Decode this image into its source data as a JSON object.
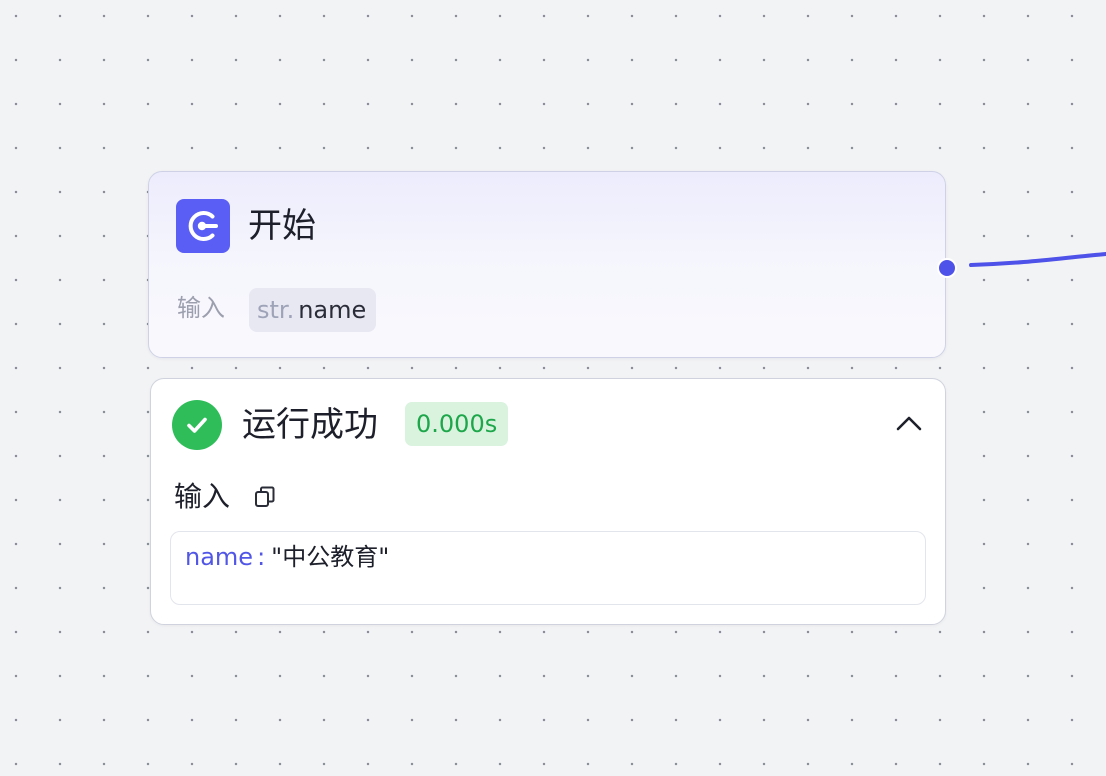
{
  "start_node": {
    "title": "开始",
    "icon": "start-node-icon",
    "input_label": "输入",
    "param": {
      "type": "str.",
      "name": "name"
    }
  },
  "result": {
    "status": "运行成功",
    "duration": "0.000s",
    "input_section_title": "输入",
    "output": {
      "key": "name",
      "separator": ":",
      "value": "\"中公教育\""
    }
  },
  "colors": {
    "accent": "#5b5ef4",
    "edge": "#4f52e8",
    "success": "#2ebd59",
    "success_bg": "#d9f3df"
  }
}
